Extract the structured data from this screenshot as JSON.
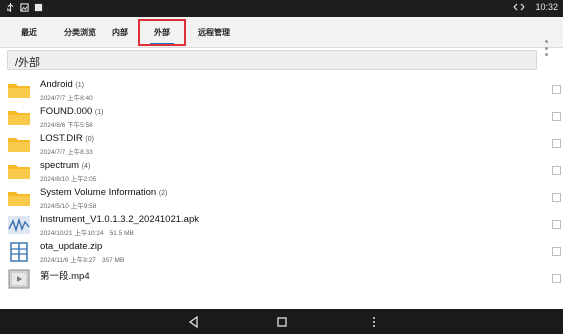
{
  "status_bar": {
    "time": "10:32",
    "icons": [
      "usb-icon",
      "image-icon",
      "square-icon",
      "link-icon"
    ]
  },
  "tabs": [
    {
      "label": "最近"
    },
    {
      "label": "分类浏览"
    },
    {
      "label": "内部"
    },
    {
      "label": "外部",
      "selected": true
    },
    {
      "label": "远程管理"
    }
  ],
  "path": "/外部",
  "files": [
    {
      "name": "Android",
      "count": "(1)",
      "date": "2024/7/7 上午8:40",
      "icon": "folder-icon"
    },
    {
      "name": "FOUND.000",
      "count": "(1)",
      "date": "2024/8/6 下午5:58",
      "icon": "folder-icon"
    },
    {
      "name": "LOST.DIR",
      "count": "(0)",
      "date": "2024/7/7 上午8:33",
      "icon": "folder-icon"
    },
    {
      "name": "spectrum",
      "count": "(4)",
      "date": "2024/8/10 上午2:05",
      "icon": "folder-icon"
    },
    {
      "name": "System Volume Information",
      "count": "(2)",
      "date": "2024/5/10 上午9:58",
      "icon": "folder-icon"
    },
    {
      "name": "Instrument_V1.0.1.3.2_20241021.apk",
      "count": "",
      "date": "2024/10/21 上午10:24",
      "size": "51.5 MB",
      "icon": "apk-icon"
    },
    {
      "name": "ota_update.zip",
      "count": "",
      "date": "2024/11/6 上午9:27",
      "size": "357 MB",
      "icon": "archive-icon"
    },
    {
      "name": "第一段.mp4",
      "count": "",
      "date": "",
      "icon": "video-icon"
    }
  ],
  "colors": {
    "accent": "#1a73c8",
    "highlight": "#e0303a",
    "folder": "#f6b928"
  }
}
